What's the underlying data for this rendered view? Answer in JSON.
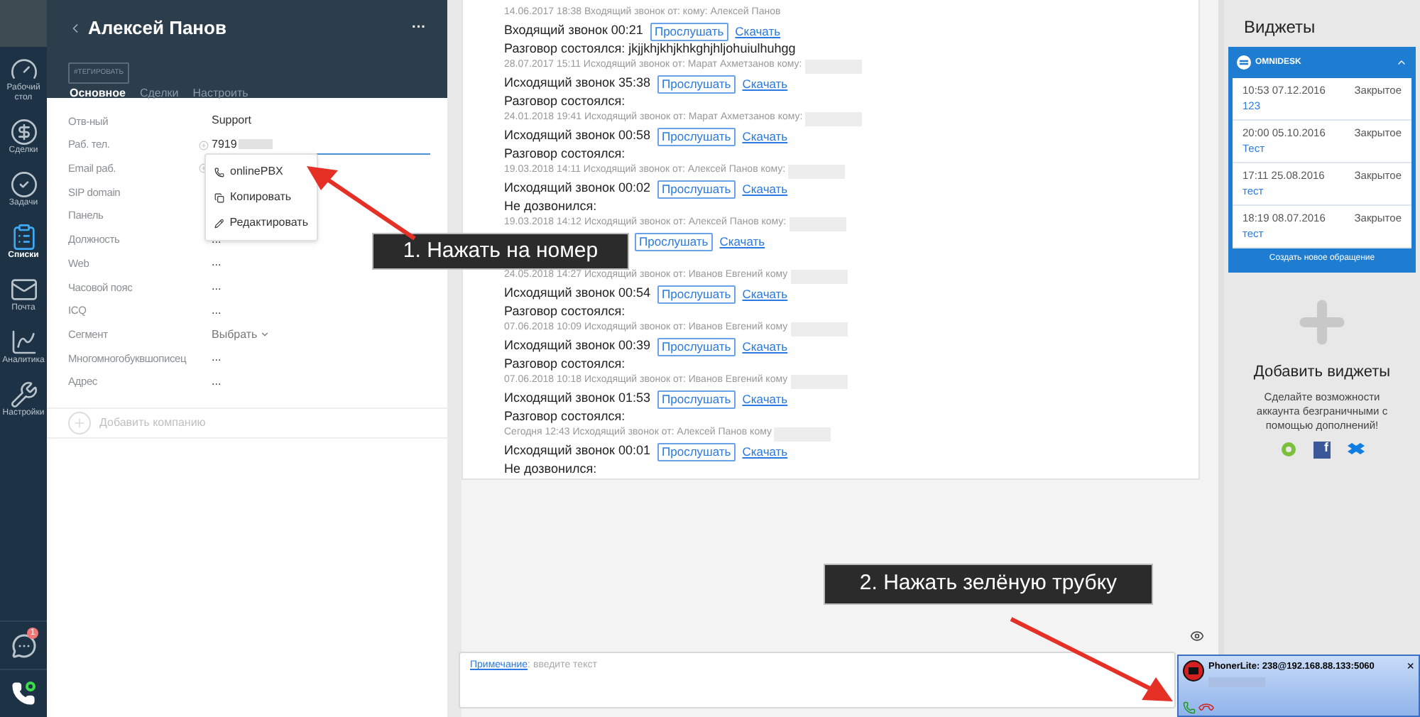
{
  "nav": {
    "items": [
      {
        "label": "Рабочий стол",
        "kind": "desk",
        "selected": false
      },
      {
        "label": "Сделки",
        "kind": "deals",
        "selected": false
      },
      {
        "label": "Задачи",
        "kind": "tasks",
        "selected": false
      },
      {
        "label": "Списки",
        "kind": "lists",
        "selected": true
      },
      {
        "label": "Почта",
        "kind": "mail",
        "selected": false
      },
      {
        "label": "Аналитика",
        "kind": "analytics",
        "selected": false
      },
      {
        "label": "Настройки",
        "kind": "settings",
        "selected": false
      }
    ],
    "chat_badge": "1"
  },
  "contact": {
    "name": "Алексей Панов",
    "menu": "···",
    "tag_button": "#ТЕГИРОВАТЬ",
    "tabs": [
      {
        "label": "Основное",
        "selected": true
      },
      {
        "label": "Сделки",
        "selected": false
      },
      {
        "label": "Настроить",
        "selected": false
      }
    ],
    "fields": [
      {
        "label": "Отв-ный",
        "kind": "text",
        "value": "Support"
      },
      {
        "label": "Раб. тел.",
        "kind": "phone",
        "value": "7919"
      },
      {
        "label": "Email раб.",
        "kind": "email"
      },
      {
        "label": "SIP domain",
        "kind": "empty"
      },
      {
        "label": "Панель",
        "kind": "empty"
      },
      {
        "label": "Должность",
        "kind": "text",
        "value": "..."
      },
      {
        "label": "Web",
        "kind": "text",
        "value": "..."
      },
      {
        "label": "Часовой пояс",
        "kind": "text",
        "value": "..."
      },
      {
        "label": "ICQ",
        "kind": "text",
        "value": "..."
      },
      {
        "label": "Сегмент",
        "kind": "select",
        "value": "Выбрать"
      },
      {
        "label": "Многомногобуквшописец",
        "kind": "text",
        "value": "..."
      },
      {
        "label": "Адрес",
        "kind": "text",
        "value": "..."
      }
    ],
    "phone_menu": [
      {
        "label": "onlinePBX",
        "kind": "call"
      },
      {
        "label": "Копировать",
        "kind": "copy"
      },
      {
        "label": "Редактировать",
        "kind": "edit"
      }
    ],
    "add_company": "Добавить компанию"
  },
  "calls": [
    {
      "header": "14.06.2017 18:38 Входящий звонок от: кому: Алексей Панов",
      "recipient_hidden": false,
      "call": "Входящий звонок 00:21",
      "listen": "Прослушать",
      "download": "Скачать",
      "result": "Разговор состоялся: jkjjkhjkhjkhkghjhljohuiulhuhgg"
    },
    {
      "header": "28.07.2017 15:11 Исходящий звонок от: Марат Ахметзанов кому:",
      "recipient_hidden": true,
      "call": "Исходящий звонок 35:38",
      "listen": "Прослушать",
      "download": "Скачать",
      "result": "Разговор состоялся:"
    },
    {
      "header": "24.01.2018 19:41 Исходящий звонок от: Марат Ахметзанов кому:",
      "recipient_hidden": true,
      "call": "Исходящий звонок 00:58",
      "listen": "Прослушать",
      "download": "Скачать",
      "result": "Разговор состоялся:"
    },
    {
      "header": "19.03.2018 14:11 Исходящий звонок от: Алексей Панов кому:",
      "recipient_hidden": true,
      "call": "Исходящий звонок 00:02",
      "listen": "Прослушать",
      "download": "Скачать",
      "result": "Не дозвонился:"
    },
    {
      "header": "19.03.2018 14:12 Исходящий звонок от: Алексей Панов кому:",
      "recipient_hidden": true,
      "listen": "Прослушать",
      "download": "Скачать"
    },
    {
      "header": "24.05.2018 14:27 Исходящий звонок от: Иванов Евгений кому",
      "recipient_hidden": true,
      "call": "Исходящий звонок 00:54",
      "listen": "Прослушать",
      "download": "Скачать",
      "result": "Разговор состоялся:"
    },
    {
      "header": "07.06.2018 10:09 Исходящий звонок от: Иванов Евгений кому",
      "recipient_hidden": true,
      "call": "Исходящий звонок 00:39",
      "listen": "Прослушать",
      "download": "Скачать",
      "result": "Разговор состоялся:"
    },
    {
      "header": "07.06.2018 10:18 Исходящий звонок от: Иванов Евгений кому",
      "recipient_hidden": true,
      "call": "Исходящий звонок 01:53",
      "listen": "Прослушать",
      "download": "Скачать",
      "result": "Разговор состоялся:"
    },
    {
      "header": "Сегодня 12:43 Исходящий звонок от: Алексей Панов кому",
      "recipient_hidden": true,
      "call": "Исходящий звонок 00:01",
      "listen": "Прослушать",
      "download": "Скачать",
      "result": "Не дозвонился:"
    }
  ],
  "note": {
    "link": "Примечание",
    "separator": ":",
    "placeholder": "введите текст"
  },
  "widgets": {
    "title": "Виджеты",
    "omnidesk": {
      "name": "OMNIDESK",
      "expanded": true,
      "tickets": [
        {
          "time": "10:53 07.12.2016",
          "status": "Закрытое",
          "subject": "123"
        },
        {
          "time": "20:00 05.10.2016",
          "status": "Закрытое",
          "subject": "Тест"
        },
        {
          "time": "17:11 25.08.2016",
          "status": "Закрытое",
          "subject": "тест"
        },
        {
          "time": "18:19 08.07.2016",
          "status": "Закрытое",
          "subject": "тест"
        }
      ],
      "create": "Создать новое обращение"
    },
    "icons": [
      {
        "kind": "flower"
      },
      {
        "kind": "letter",
        "text": "f"
      },
      {
        "kind": "box"
      }
    ],
    "add_title": "Добавить виджеты",
    "add_text": "Сделайте возможности аккаунта безграничными с помощью дополнений!"
  },
  "callouts": [
    "1. Нажать на номер",
    "2. Нажать зелёную трубку"
  ],
  "phoner": {
    "title": "PhonerLite: 238@192.168.88.133:5060",
    "close": "×"
  }
}
